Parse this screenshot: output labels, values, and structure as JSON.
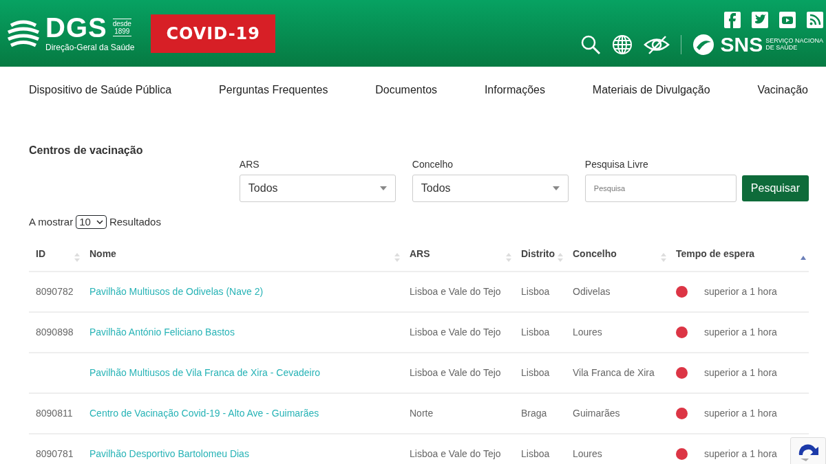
{
  "header": {
    "logo": {
      "name": "DGS",
      "since_label": "desde",
      "since_year": "1899",
      "subtitle": "Direção-Geral da Saúde"
    },
    "covid_badge": "COVID-19",
    "sns": {
      "name": "SNS",
      "line1": "SERVIÇO NACIONA",
      "line2": "DE SAÚDE"
    }
  },
  "nav": [
    "Dispositivo de Saúde Pública",
    "Perguntas Frequentes",
    "Documentos",
    "Informações",
    "Materiais de Divulgação",
    "Vacinação"
  ],
  "section_title": "Centros de vacinação",
  "filters": [
    {
      "kind": "select",
      "label": "ARS",
      "value": "Todos"
    },
    {
      "kind": "select",
      "label": "Concelho",
      "value": "Todos"
    },
    {
      "kind": "text",
      "label": "Pesquisa Livre",
      "placeholder": "Pesquisa"
    }
  ],
  "search_button": "Pesquisar",
  "page_size": {
    "prefix": "A mostrar",
    "value": "10",
    "suffix": "Resultados"
  },
  "table": {
    "columns": [
      {
        "label": "ID",
        "sorted": false
      },
      {
        "label": "Nome",
        "sorted": false
      },
      {
        "label": "ARS",
        "sorted": false
      },
      {
        "label": "Distrito",
        "sorted": false
      },
      {
        "label": "Concelho",
        "sorted": false
      },
      {
        "label": "Tempo de espera",
        "sorted": true
      }
    ],
    "rows": [
      {
        "id": "8090782",
        "nome": "Pavilhão Multiusos de Odivelas (Nave 2)",
        "ars": "Lisboa e Vale do Tejo",
        "distrito": "Lisboa",
        "concelho": "Odivelas",
        "color": "#dc3545",
        "tempo": "superior a 1 hora"
      },
      {
        "id": "8090898",
        "nome": "Pavilhão António Feliciano Bastos",
        "ars": "Lisboa e Vale do Tejo",
        "distrito": "Lisboa",
        "concelho": "Loures",
        "color": "#dc3545",
        "tempo": "superior a 1 hora"
      },
      {
        "nome": "Pavilhão Multiusos de Vila Franca de Xira - Cevadeiro",
        "ars": "Lisboa e Vale do Tejo",
        "distrito": "Lisboa",
        "concelho": "Vila Franca de Xira",
        "color": "#dc3545",
        "tempo": "superior a 1 hora"
      },
      {
        "id": "8090811",
        "nome": "Centro de Vacinação Covid-19 - Alto Ave - Guimarães",
        "ars": "Norte",
        "distrito": "Braga",
        "concelho": "Guimarães",
        "color": "#dc3545",
        "tempo": "superior a 1 hora"
      },
      {
        "id": "8090781",
        "nome": "Pavilhão Desportivo Bartolomeu Dias",
        "ars": "Lisboa e Vale do Tejo",
        "distrito": "Lisboa",
        "concelho": "Loures",
        "color": "#dc3545",
        "tempo": "superior a 1 hora"
      }
    ]
  }
}
